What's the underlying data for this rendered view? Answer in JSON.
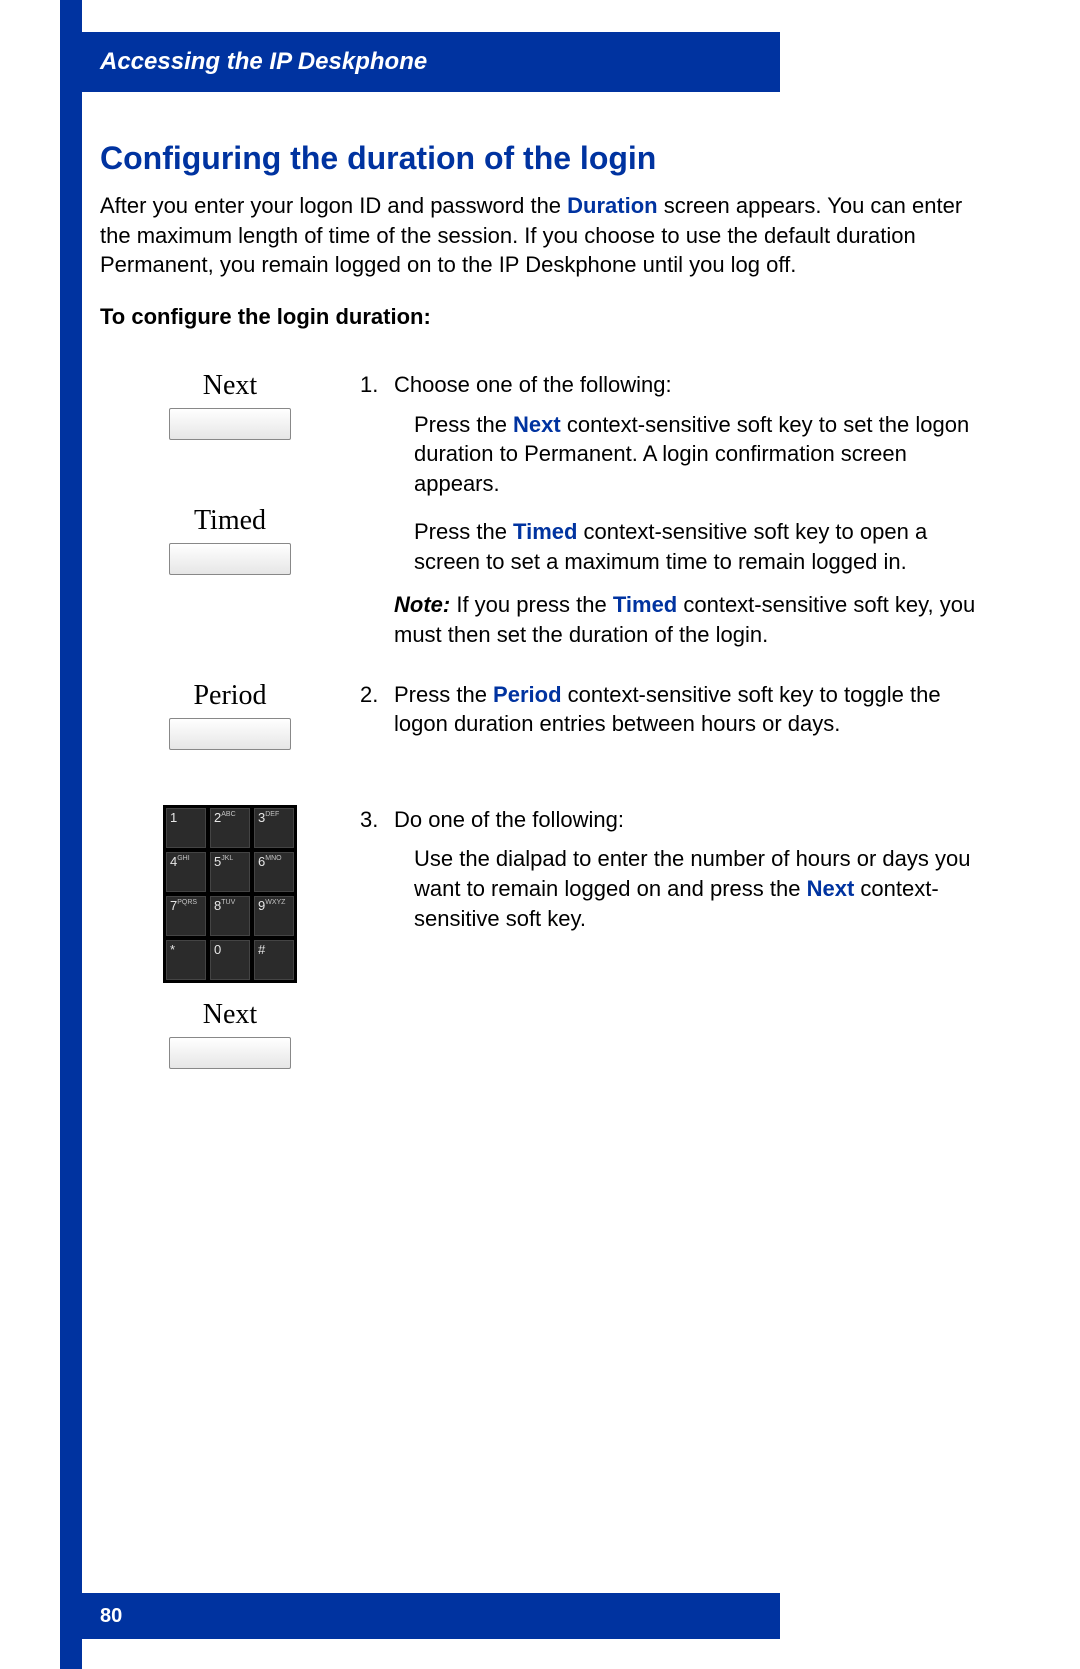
{
  "header": {
    "title": "Accessing the IP Deskphone"
  },
  "section": {
    "title": "Configuring the duration of the login"
  },
  "intro": {
    "pre": "After you enter your logon ID and password the ",
    "kw": "Duration",
    "post": " screen appears. You can enter the maximum length of time of the session. If you choose to use the default duration Permanent, you remain logged on to the IP Deskphone until you log off."
  },
  "subheading": "To configure the login duration:",
  "softkeys": {
    "next": "Next",
    "timed": "Timed",
    "period": "Period",
    "next2": "Next"
  },
  "dialpad": [
    {
      "d": "1",
      "l": ""
    },
    {
      "d": "2",
      "l": "ABC"
    },
    {
      "d": "3",
      "l": "DEF"
    },
    {
      "d": "4",
      "l": "GHI"
    },
    {
      "d": "5",
      "l": "JKL"
    },
    {
      "d": "6",
      "l": "MNO"
    },
    {
      "d": "7",
      "l": "PQRS"
    },
    {
      "d": "8",
      "l": "TUV"
    },
    {
      "d": "9",
      "l": "WXYZ"
    },
    {
      "d": "*",
      "l": ""
    },
    {
      "d": "0",
      "l": ""
    },
    {
      "d": "#",
      "l": ""
    }
  ],
  "steps": {
    "s1": {
      "num": "1.",
      "lead": "Choose one of the following:",
      "a_pre": "Press the   ",
      "a_kw": "Next",
      "a_post": " context-sensitive soft key to set the logon duration to Permanent. A login confirmation screen appears.",
      "b_pre": "Press the   ",
      "b_kw": "Timed",
      "b_post": " context-sensitive soft key to open a screen to set a maximum time to remain logged in.",
      "note_label": "Note:",
      "note_pre": "  If you press the ",
      "note_kw": "Timed",
      "note_post": " context-sensitive soft key, you must then set the duration of the login."
    },
    "s2": {
      "num": "2.",
      "pre": "Press the ",
      "kw": "Period",
      "post": " context-sensitive soft key to toggle the logon duration entries between hours or days."
    },
    "s3": {
      "num": "3.",
      "lead": "Do one of the following:",
      "a_pre": "Use the dialpad to enter the number of hours or days you want to remain logged on and press the ",
      "a_kw": "Next",
      "a_post": " context-sensitive soft key."
    }
  },
  "page_number": "80"
}
